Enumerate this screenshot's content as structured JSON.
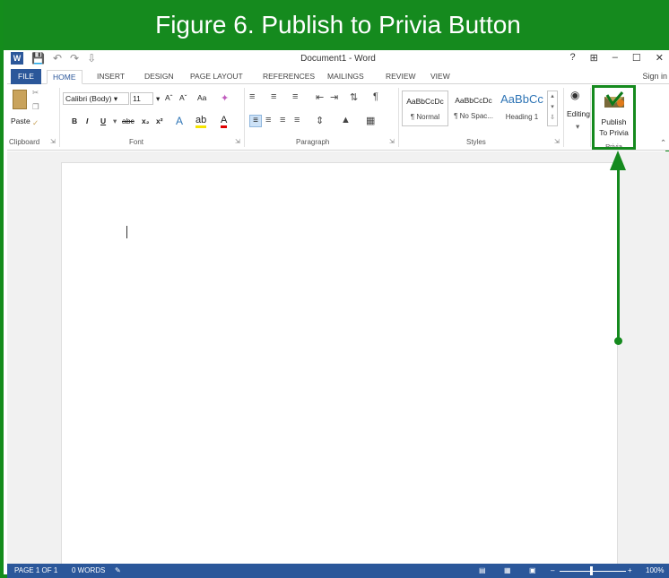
{
  "figure": {
    "title": "Figure 6. Publish to Privia Button"
  },
  "colors": {
    "figure_green": "#158a1e",
    "word_blue": "#2b579a"
  },
  "window": {
    "title": "Document1 - Word",
    "controls": [
      "?",
      "⊞",
      "–",
      "☐",
      "✕"
    ],
    "sign_in": "Sign in"
  },
  "qat": {
    "undo": "↶",
    "redo": "↷",
    "customize": "⇩"
  },
  "tabs": {
    "file": "FILE",
    "home": "HOME",
    "insert": "INSERT",
    "design": "DESIGN",
    "page_layout": "PAGE LAYOUT",
    "references": "REFERENCES",
    "mailings": "MAILINGS",
    "review": "REVIEW",
    "view": "VIEW"
  },
  "ribbon": {
    "clipboard": {
      "paste": "Paste",
      "label": "Clipboard"
    },
    "font": {
      "name": "Calibri (Body)",
      "size": "11",
      "grow": "Aˆ",
      "shrink": "Aˇ",
      "case": "Aa",
      "bold": "B",
      "italic": "I",
      "underline": "U",
      "strike": "abc",
      "sub": "x₂",
      "sup": "x²",
      "label": "Font"
    },
    "paragraph": {
      "label": "Paragraph"
    },
    "styles": {
      "items": [
        {
          "sample": "AaBbCcDc",
          "name": "¶ Normal"
        },
        {
          "sample": "AaBbCcDc",
          "name": "¶ No Spac..."
        },
        {
          "sample": "AaBbCc",
          "name": "Heading 1"
        }
      ],
      "label": "Styles"
    },
    "editing": {
      "label": "Editing"
    },
    "privia": {
      "button_line1": "Publish",
      "button_line2": "To Privia",
      "group_label": "Privia"
    }
  },
  "status": {
    "page": "PAGE 1 OF 1",
    "words": "0 WORDS",
    "zoom": "100%"
  }
}
